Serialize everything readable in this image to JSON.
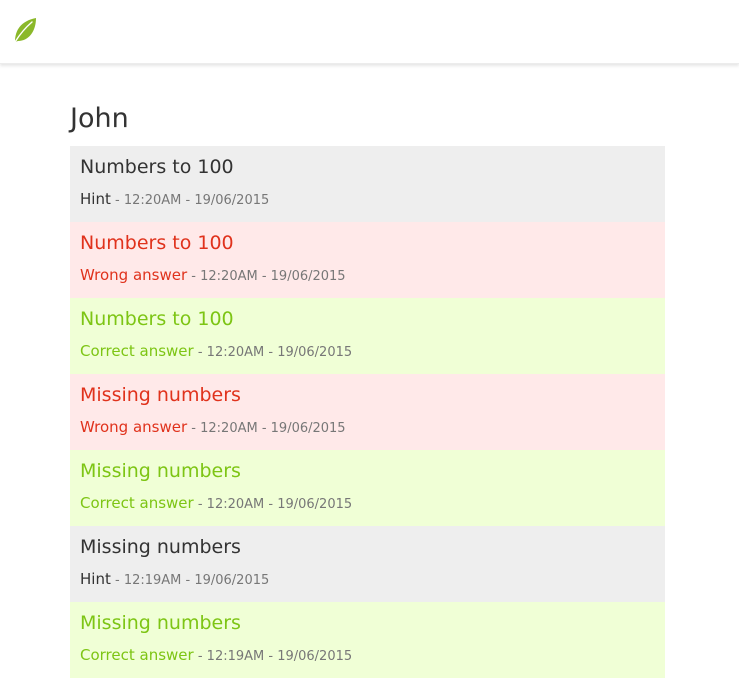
{
  "header": {
    "logo_icon": "leaf-icon",
    "logo_color": "#8bb82a"
  },
  "page": {
    "title": "John"
  },
  "colors": {
    "hint_bg": "#eeeeee",
    "wrong_bg": "#ffe9e9",
    "wrong_text": "#e0321c",
    "correct_bg": "#f0ffd6",
    "correct_text": "#7dc514"
  },
  "activities": [
    {
      "title": "Numbers to 100",
      "type": "Hint",
      "separator": " - ",
      "time": "12:20AM - 19/06/2015",
      "status": "hint"
    },
    {
      "title": "Numbers to 100",
      "type": "Wrong answer",
      "separator": " - ",
      "time": "12:20AM - 19/06/2015",
      "status": "wrong"
    },
    {
      "title": "Numbers to 100",
      "type": "Correct answer",
      "separator": " - ",
      "time": "12:20AM - 19/06/2015",
      "status": "correct"
    },
    {
      "title": "Missing numbers",
      "type": "Wrong answer",
      "separator": " - ",
      "time": "12:20AM - 19/06/2015",
      "status": "wrong"
    },
    {
      "title": "Missing numbers",
      "type": "Correct answer",
      "separator": " - ",
      "time": "12:20AM - 19/06/2015",
      "status": "correct"
    },
    {
      "title": "Missing numbers",
      "type": "Hint",
      "separator": " - ",
      "time": "12:19AM - 19/06/2015",
      "status": "hint"
    },
    {
      "title": "Missing numbers",
      "type": "Correct answer",
      "separator": " - ",
      "time": "12:19AM - 19/06/2015",
      "status": "correct"
    }
  ]
}
